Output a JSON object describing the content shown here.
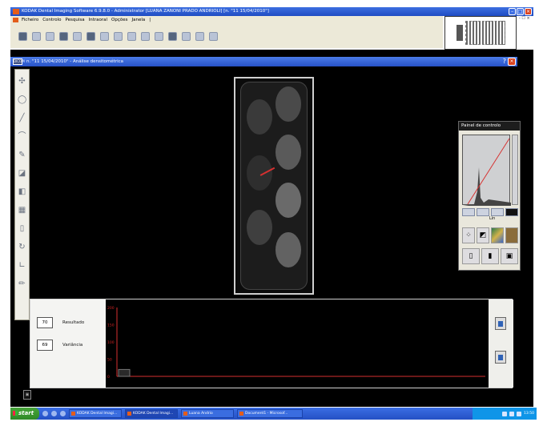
{
  "app": {
    "title": "KODAK Dental Imaging Software  6.9.8.0  -  Administrator   [LUANA ZANONI PRADO ANDRIOLI]  [n. \"11 15/04/2010\"]"
  },
  "menu": [
    "Ficheiro",
    "Controlo",
    "Pesquisa",
    "Intraoral",
    "Opções",
    "Janela",
    "|"
  ],
  "child_window": {
    "icon_label": "DICOM",
    "title": "n. \"11 15/04/2010\"  -  Análise densitométrica",
    "help": "?"
  },
  "control_panel": {
    "title": "Painel de controlo",
    "lut_label": "Lin"
  },
  "readouts": [
    {
      "value": "70",
      "label": "Resultado"
    },
    {
      "value": "69",
      "label": "Variância"
    }
  ],
  "graph": {
    "y_ticks": [
      "200",
      "150",
      "100",
      "50",
      "0"
    ],
    "bar_value": 20
  },
  "taskbar": {
    "start": "start",
    "tasks": [
      "KODAK Dental Imagi...",
      "KODAK Dental Imagi...",
      "Luana Andrio",
      "Document1 - Microsof..."
    ],
    "active_task": 1,
    "clock": "13:50"
  },
  "icons": {
    "toolbar": [
      "open-icon",
      "sync-icon",
      "layout-icon",
      "scanner-icon",
      "stack-icon",
      "home-icon",
      "print-icon",
      "slot1-icon",
      "slot2-icon",
      "slot3-icon",
      "slot4-icon",
      "disk-icon",
      "pin-icon",
      "pin2-icon",
      "window-icon"
    ],
    "left_tools": [
      "pan-icon",
      "circle-icon",
      "brush-icon",
      "ruler-icon",
      "pen-icon",
      "measure-icon",
      "color-picker-icon",
      "grid-icon",
      "eraser-icon",
      "rotate-icon",
      "angle-icon",
      "pencil-icon"
    ]
  },
  "colors": {
    "titlebar": "#2452c7",
    "graph_baseline": "#d63030",
    "window_close": "#d9421f"
  }
}
